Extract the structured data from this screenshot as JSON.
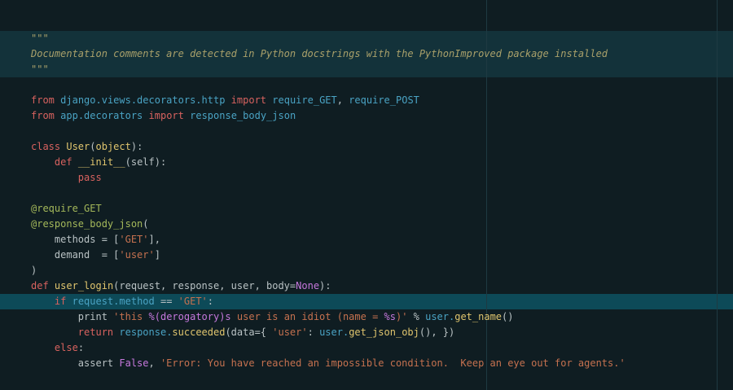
{
  "colors": {
    "background": "#0f1d22",
    "docstring_band": "#13323a",
    "current_line": "#0d4a58",
    "ruler": "#1e3a42",
    "default": "#b9c2c4",
    "comment": "#a9a06a",
    "keyword": "#d8625f",
    "module": "#4aa3c4",
    "decorator": "#a4b85a",
    "function": "#e0c56e",
    "string": "#c5714f",
    "constant": "#c678dd"
  },
  "code_lines": [
    [
      {
        "t": "\"\"\"",
        "c": "comment"
      }
    ],
    [
      {
        "t": "Documentation comments are detected in Python docstrings with the PythonImproved package installed",
        "c": "comment",
        "i": true
      }
    ],
    [
      {
        "t": "\"\"\"",
        "c": "comment"
      }
    ],
    [],
    [
      {
        "t": "from",
        "c": "keyword"
      },
      {
        "t": " "
      },
      {
        "t": "django.views.decorators.http",
        "c": "module"
      },
      {
        "t": " "
      },
      {
        "t": "import",
        "c": "keyword"
      },
      {
        "t": " "
      },
      {
        "t": "require_GET",
        "c": "module"
      },
      {
        "t": ", "
      },
      {
        "t": "require_POST",
        "c": "module"
      }
    ],
    [
      {
        "t": "from",
        "c": "keyword"
      },
      {
        "t": " "
      },
      {
        "t": "app.decorators",
        "c": "module"
      },
      {
        "t": " "
      },
      {
        "t": "import",
        "c": "keyword"
      },
      {
        "t": " "
      },
      {
        "t": "response_body_json",
        "c": "module"
      }
    ],
    [],
    [
      {
        "t": "class",
        "c": "keyword"
      },
      {
        "t": " "
      },
      {
        "t": "User",
        "c": "function"
      },
      {
        "t": "("
      },
      {
        "t": "object",
        "c": "function"
      },
      {
        "t": "):"
      }
    ],
    [
      {
        "t": "    "
      },
      {
        "t": "def",
        "c": "keyword"
      },
      {
        "t": " "
      },
      {
        "t": "__init__",
        "c": "function"
      },
      {
        "t": "(self):"
      }
    ],
    [
      {
        "t": "        "
      },
      {
        "t": "pass",
        "c": "keyword"
      }
    ],
    [],
    [
      {
        "t": "@require_GET",
        "c": "decorator"
      }
    ],
    [
      {
        "t": "@response_body_json",
        "c": "decorator"
      },
      {
        "t": "("
      }
    ],
    [
      {
        "t": "    methods = ["
      },
      {
        "t": "'GET'",
        "c": "string"
      },
      {
        "t": "],"
      }
    ],
    [
      {
        "t": "    demand  = ["
      },
      {
        "t": "'user'",
        "c": "string"
      },
      {
        "t": "]"
      }
    ],
    [
      {
        "t": ")"
      }
    ],
    [
      {
        "t": "def",
        "c": "keyword"
      },
      {
        "t": " "
      },
      {
        "t": "user_login",
        "c": "function"
      },
      {
        "t": "(request, response, user, body="
      },
      {
        "t": "None",
        "c": "constant"
      },
      {
        "t": "):"
      }
    ],
    [
      {
        "t": "    "
      },
      {
        "t": "if",
        "c": "keyword"
      },
      {
        "t": " "
      },
      {
        "t": "request.method",
        "c": "module"
      },
      {
        "t": " == "
      },
      {
        "t": "'GET'",
        "c": "string"
      },
      {
        "t": ":"
      }
    ],
    [
      {
        "t": "        print "
      },
      {
        "t": "'this ",
        "c": "string"
      },
      {
        "t": "%(derogatory)s",
        "c": "constant"
      },
      {
        "t": " user is an idiot (name = ",
        "c": "string"
      },
      {
        "t": "%s",
        "c": "constant"
      },
      {
        "t": ")'",
        "c": "string"
      },
      {
        "t": " % "
      },
      {
        "t": "user.",
        "c": "module"
      },
      {
        "t": "get_name",
        "c": "function"
      },
      {
        "t": "()"
      }
    ],
    [
      {
        "t": "        "
      },
      {
        "t": "return",
        "c": "keyword"
      },
      {
        "t": " "
      },
      {
        "t": "response.",
        "c": "module"
      },
      {
        "t": "succeeded",
        "c": "function"
      },
      {
        "t": "(data={ "
      },
      {
        "t": "'user'",
        "c": "string"
      },
      {
        "t": ": "
      },
      {
        "t": "user.",
        "c": "module"
      },
      {
        "t": "get_json_obj",
        "c": "function"
      },
      {
        "t": "(), })"
      }
    ],
    [
      {
        "t": "    "
      },
      {
        "t": "else",
        "c": "keyword"
      },
      {
        "t": ":"
      }
    ],
    [
      {
        "t": "        assert "
      },
      {
        "t": "False",
        "c": "constant"
      },
      {
        "t": ", "
      },
      {
        "t": "'Error: You have reached an impossible condition.  Keep an eye out for agents.'",
        "c": "string"
      }
    ]
  ]
}
